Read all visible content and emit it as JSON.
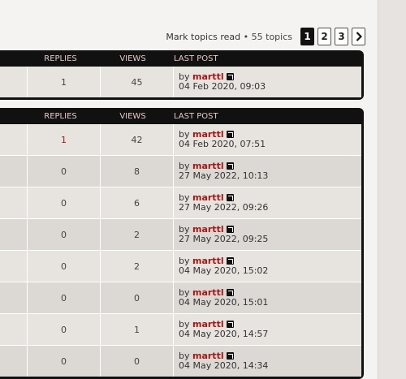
{
  "toolbar": {
    "mark_read": "Mark topics read",
    "topic_count": " • 55 topics",
    "pages": [
      "1",
      "2",
      "3"
    ],
    "active_page": "1"
  },
  "headers": {
    "replies": "REPLIES",
    "views": "VIEWS",
    "last_post": "LAST POST"
  },
  "announcements": [
    {
      "replies": "1",
      "views": "45",
      "by": "by",
      "author": "marttl",
      "date": "04 Feb 2020, 09:03"
    }
  ],
  "topics": [
    {
      "replies": "1",
      "views": "42",
      "by": "by",
      "author": "marttl",
      "date": "04 Feb 2020, 07:51"
    },
    {
      "replies": "0",
      "views": "8",
      "by": "by",
      "author": "marttl",
      "date": "27 May 2022, 10:13"
    },
    {
      "replies": "0",
      "views": "6",
      "by": "by",
      "author": "marttl",
      "date": "27 May 2022, 09:26"
    },
    {
      "replies": "0",
      "views": "2",
      "by": "by",
      "author": "marttl",
      "date": "27 May 2022, 09:25"
    },
    {
      "replies": "0",
      "views": "2",
      "by": "by",
      "author": "marttl",
      "date": "04 May 2020, 15:02"
    },
    {
      "replies": "0",
      "views": "0",
      "by": "by",
      "author": "marttl",
      "date": "04 May 2020, 15:01"
    },
    {
      "replies": "0",
      "views": "1",
      "by": "by",
      "author": "marttl",
      "date": "04 May 2020, 14:57"
    },
    {
      "replies": "0",
      "views": "0",
      "by": "by",
      "author": "marttl",
      "date": "04 May 2020, 14:34"
    }
  ],
  "colors": {
    "header_bg": "#111111",
    "header_text": "#e8c9c9",
    "author": "#a41818",
    "row_odd": "#e7e3df",
    "row_even": "#dcd8d4"
  }
}
